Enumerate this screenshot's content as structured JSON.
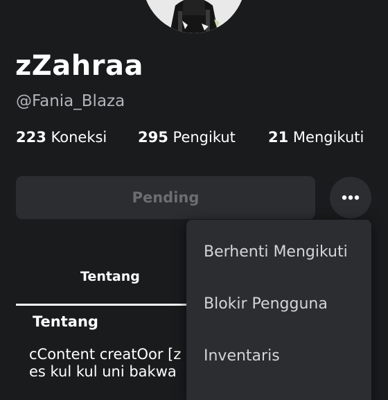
{
  "profile": {
    "display_name": "zZahraa",
    "username": "@Fania_Blaza"
  },
  "stats": {
    "connections_count": "223",
    "connections_label": "Koneksi",
    "followers_count": "295",
    "followers_label": "Pengikut",
    "following_count": "21",
    "following_label": "Mengikuti"
  },
  "actions": {
    "pending_label": "Pending",
    "more_icon": "more-horizontal-icon"
  },
  "tabs": [
    {
      "label": "Tentang",
      "active": true
    }
  ],
  "about": {
    "title": "Tentang",
    "text_line1": "cContent creatOor [z",
    "text_line2": "es kul kul uni bakwa"
  },
  "menu": {
    "items": [
      {
        "label": "Berhenti Mengikuti"
      },
      {
        "label": "Blokir Pengguna"
      },
      {
        "label": "Inventaris"
      }
    ]
  },
  "colors": {
    "background": "#1a1b1d",
    "surface": "#2c2d30",
    "text_primary": "#ffffff",
    "text_secondary": "#b3b5b8",
    "button_disabled_text": "#6b6d72"
  }
}
